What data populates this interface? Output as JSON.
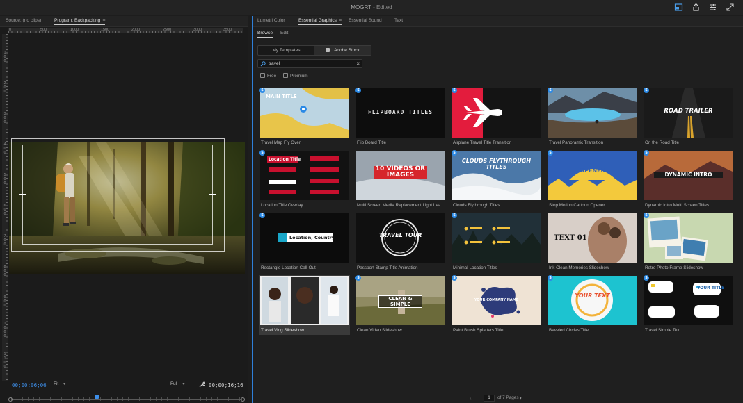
{
  "app": {
    "title": "MOGRT",
    "status": "- Edited"
  },
  "left_panel": {
    "tabs": [
      {
        "label": "Source: (no clips)"
      },
      {
        "label": "Program: Backpacking"
      }
    ],
    "ruler_labels": [
      "0",
      "500",
      "1000",
      "1500",
      "2000",
      "2500",
      "3000",
      "3500"
    ],
    "ruler_left_labels": [
      "1\n0\n0",
      "2\n0\n0",
      "3\n0\n0",
      "4\n0\n0",
      "5\n0\n0",
      "6\n0\n0",
      "7\n0\n0",
      "8\n0\n0",
      "9\n0\n0",
      "1\n0\n0\n0",
      "1\n1\n0\n0"
    ],
    "current_timecode": "00;00;06;06",
    "zoom": "Fit",
    "resolution": "Full",
    "duration_timecode": "00;00;16;16"
  },
  "right_panel": {
    "tabs": [
      {
        "label": "Lumetri Color"
      },
      {
        "label": "Essential Graphics"
      },
      {
        "label": "Essential Sound"
      },
      {
        "label": "Text"
      }
    ],
    "subtabs": [
      {
        "label": "Browse"
      },
      {
        "label": "Edit"
      }
    ],
    "source_toggle": {
      "my_templates": "My Templates",
      "adobe_stock": "Adobe Stock"
    },
    "search": {
      "value": "travel"
    },
    "filters": {
      "free": "Free",
      "premium": "Premium"
    },
    "templates": [
      {
        "label": "Travel Map Fly Over",
        "thumb_text": "MAIN TITLE"
      },
      {
        "label": "Flip Board Title",
        "thumb_text": "FLIPBOARD TITLES"
      },
      {
        "label": "Airplane Travel Title Transition",
        "thumb_text": ""
      },
      {
        "label": "Travel Panoramic Transition",
        "thumb_text": ""
      },
      {
        "label": "On the Road Title",
        "thumb_text": "ROAD TRAILER"
      },
      {
        "label": "Location Title Overlay",
        "thumb_text": "Location Title"
      },
      {
        "label": "Multi Screen Media Replacement Light Leaks...",
        "thumb_text": "10 VIDEOS OR IMAGES"
      },
      {
        "label": "Clouds Flythrough Titles",
        "thumb_text": "CLOUDS FLYTHROUGH TITLES"
      },
      {
        "label": "Stop Motion Cartoon Opener",
        "thumb_text": "OPENER"
      },
      {
        "label": "Dynamic Intro Multi Screen Titles",
        "thumb_text": "DYNAMIC INTRO"
      },
      {
        "label": "Rectangle Location Call-Out",
        "thumb_text": "Location, Country"
      },
      {
        "label": "Passport Stamp Title Animation",
        "thumb_text": "TRAVEL TOUR"
      },
      {
        "label": "Minimal Location Titles",
        "thumb_text": ""
      },
      {
        "label": "Ink Clean Memories Slideshow",
        "thumb_text": "TEXT 01"
      },
      {
        "label": "Retro Photo Frame Slideshow",
        "thumb_text": ""
      },
      {
        "label": "Travel Vlog Slideshow",
        "thumb_text": ""
      },
      {
        "label": "Clean Video Slideshow",
        "thumb_text": "CLEAN & SIMPLE"
      },
      {
        "label": "Paint Brush Splatters Title",
        "thumb_text": "YOUR COMPANY NAME"
      },
      {
        "label": "Beveled Circles Title",
        "thumb_text": "YOUR TEXT"
      },
      {
        "label": "Travel Simple Text",
        "thumb_text": "YOUR TITLE"
      }
    ],
    "pagination": {
      "prev": "‹",
      "page": "1",
      "of_pages": "of 7 Pages",
      "next": "›"
    }
  },
  "colors": {
    "accent": "#2f7fd8",
    "timecode": "#3d8ee8",
    "stock_badge": "#2b8ae6"
  }
}
